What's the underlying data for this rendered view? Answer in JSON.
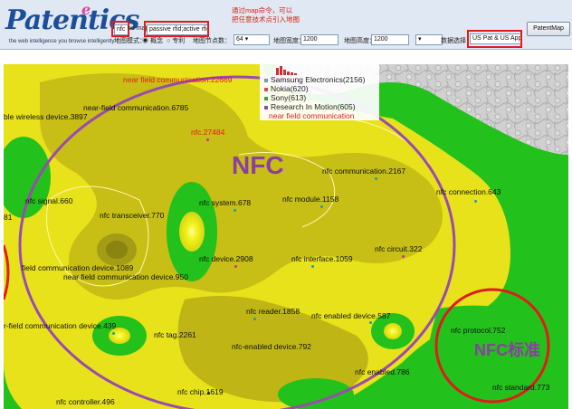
{
  "toolbar": {
    "logo_text": "Patentics",
    "logo_tagline": "the web intelligence you browse intelligently",
    "query_term1": "nfc",
    "and_label": "nd map",
    "query_term2": "passive rfid;active rfid",
    "note_line1": "通过map命令，可以",
    "note_line2": "把任意技术点引入地图",
    "mode_label": "地图模式：",
    "mode_option1": "概念",
    "mode_option2": "专利",
    "nodes_label": "地图节点数：",
    "nodes_value": "64",
    "width_label": "地图宽度：",
    "width_value": "1200",
    "height_label": "地图高度：",
    "height_value": "1200",
    "datasource_label": "数据选择",
    "datasource_value": "US Pat & US App",
    "patentmap_button": "PatentMap"
  },
  "legend": {
    "items": [
      {
        "label": "Samsung Electronics(2156)",
        "color": "#7b8fd0"
      },
      {
        "label": "Nokia(620)",
        "color": "#d05050"
      },
      {
        "label": "Sony(613)",
        "color": "#40a040"
      },
      {
        "label": "Research In Motion(605)",
        "color": "#8050b0"
      }
    ],
    "extra": "near field communication"
  },
  "map": {
    "big_nfc": "NFC",
    "big_nfc_std": "NFC标准",
    "labels": [
      {
        "text": "near field communication.22669",
        "red": true
      },
      {
        "text": "ble wireless device.3897",
        "red": false
      },
      {
        "text": "near-field communication.6785",
        "red": false
      },
      {
        "text": "nfc.27484",
        "red": true
      },
      {
        "text": "nfc communication.2167",
        "red": false
      },
      {
        "text": "nfc signal.660",
        "red": false
      },
      {
        "text": "nfc system.678",
        "red": false
      },
      {
        "text": "nfc module.1158",
        "red": false
      },
      {
        "text": "nfc connection.643",
        "red": false
      },
      {
        "text": "81",
        "red": false
      },
      {
        "text": "nfc transceiver.770",
        "red": false
      },
      {
        "text": "nfc device.2908",
        "red": false
      },
      {
        "text": "nfc interface.1059",
        "red": false
      },
      {
        "text": "nfc circuit.322",
        "red": false
      },
      {
        "text": "field communication device.1089",
        "red": false
      },
      {
        "text": "near field communication device.950",
        "red": false
      },
      {
        "text": "nfc reader.1858",
        "red": false
      },
      {
        "text": "nfc enabled device.587",
        "red": false
      },
      {
        "text": "r-field communication device.439",
        "red": false
      },
      {
        "text": "nfc tag.2261",
        "red": false
      },
      {
        "text": "nfc-enabled device.792",
        "red": false
      },
      {
        "text": "nfc protocol.752",
        "red": false
      },
      {
        "text": "nfc enabled.786",
        "red": false
      },
      {
        "text": "nfc chip.1619",
        "red": false
      },
      {
        "text": "nfc standard.773",
        "red": false
      },
      {
        "text": "nfc controller.496",
        "red": false
      }
    ]
  }
}
